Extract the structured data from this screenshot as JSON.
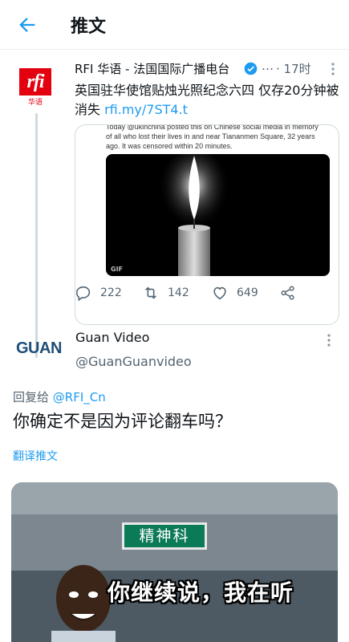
{
  "header": {
    "title": "推文"
  },
  "quoted_tweet": {
    "author_name": "RFI 华语 - 法国国际广播电台",
    "dots": "…",
    "time": "· 17时",
    "text": "英国驻华使馆贴烛光照纪念六四 仅存20分钟被消失 ",
    "link": "rfi.my/7ST4.t",
    "logo_text": "rfi",
    "logo_sub": "华语",
    "media": {
      "caption": "Today @ukinchina posted this on Chinese social media in memory of all who lost their lives in and near Tiananmen Square, 32 years ago. It was censored within 20 minutes.",
      "badge": "GIF"
    },
    "actions": {
      "reply_count": "222",
      "retweet_count": "142",
      "like_count": "649"
    },
    "colors": {
      "brand": "#e3000f",
      "verified": "#1d9bf0"
    }
  },
  "reply_tweet": {
    "logo_text": "GUAN",
    "author_name": "Guan Video",
    "handle": "@GuanGuanvideo",
    "reply_prefix": "回复给 ",
    "reply_target": "@RFI_Cn",
    "text": "你确定不是因为评论翻车吗？",
    "translate_label": "翻译推文",
    "media": {
      "sign_text": "精神科",
      "caption": "你继续说，我在听"
    }
  },
  "icons": [
    "back-arrow-icon",
    "verified-icon",
    "more-vertical-icon",
    "reply-icon",
    "retweet-icon",
    "like-icon",
    "share-icon"
  ],
  "accent_color": "#1d9bf0"
}
